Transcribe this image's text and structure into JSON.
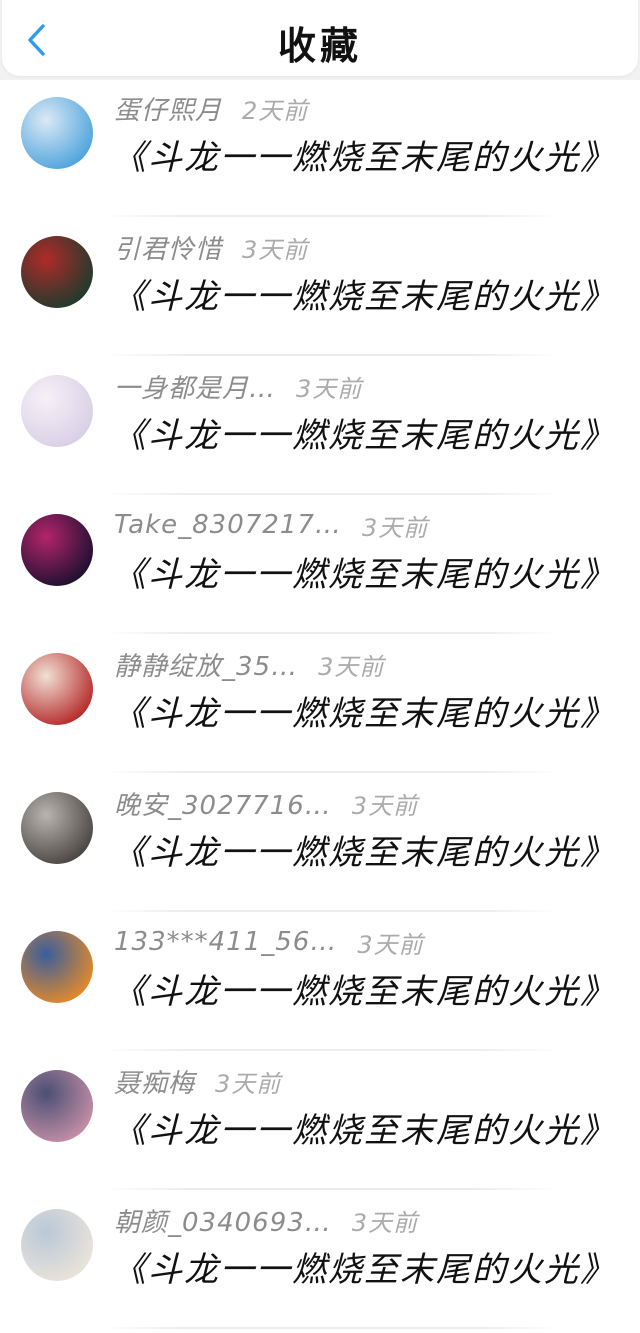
{
  "header": {
    "title": "收藏",
    "back_icon": "chevron-left-icon",
    "accent_color": "#2f9bec"
  },
  "items": [
    {
      "username": "蛋仔熙月",
      "time": "2天前",
      "title": "《斗龙一一燃烧至末尾的火光》",
      "avatar_colors": [
        "#4ea3dd",
        "#dbe9f5"
      ]
    },
    {
      "username": "引君怜惜",
      "time": "3天前",
      "title": "《斗龙一一燃烧至末尾的火光》",
      "avatar_colors": [
        "#1d3b2c",
        "#b02a2a"
      ]
    },
    {
      "username": "一身都是月…",
      "time": "3天前",
      "title": "《斗龙一一燃烧至末尾的火光》",
      "avatar_colors": [
        "#d9cfe6",
        "#f6f1f7"
      ]
    },
    {
      "username": "Take_8307217…",
      "time": "3天前",
      "title": "《斗龙一一燃烧至末尾的火光》",
      "avatar_colors": [
        "#1c1030",
        "#b3246b"
      ]
    },
    {
      "username": "静静绽放_35…",
      "time": "3天前",
      "title": "《斗龙一一燃烧至末尾的火光》",
      "avatar_colors": [
        "#b52a2a",
        "#f1e0d5"
      ]
    },
    {
      "username": "晚安_3027716…",
      "time": "3天前",
      "title": "《斗龙一一燃烧至末尾的火光》",
      "avatar_colors": [
        "#4a4543",
        "#b9b4ae"
      ]
    },
    {
      "username": "133***411_56…",
      "time": "3天前",
      "title": "《斗龙一一燃烧至末尾的火光》",
      "avatar_colors": [
        "#e38a2a",
        "#3a5e9c"
      ]
    },
    {
      "username": "聂痴梅",
      "time": "3天前",
      "title": "《斗龙一一燃烧至末尾的火光》",
      "avatar_colors": [
        "#c48ea6",
        "#4b4f74"
      ]
    },
    {
      "username": "朝颜_0340693…",
      "time": "3天前",
      "title": "《斗龙一一燃烧至末尾的火光》",
      "avatar_colors": [
        "#eae3d9",
        "#b9c8d8"
      ]
    }
  ]
}
